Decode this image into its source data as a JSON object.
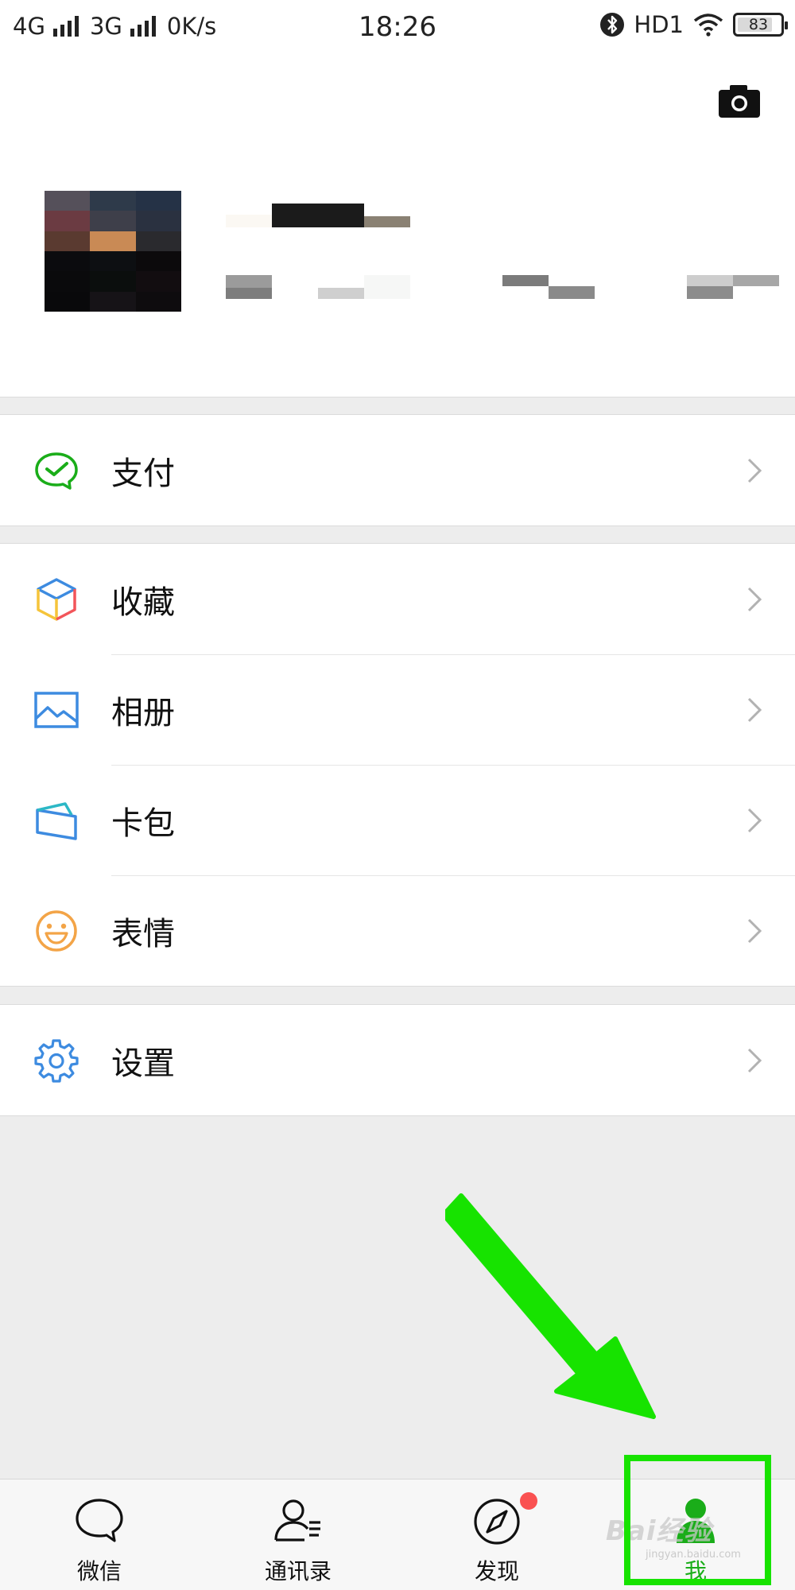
{
  "status_bar": {
    "network1": "4G",
    "network2": "3G",
    "speed": "0K/s",
    "time": "18:26",
    "hd": "HD1",
    "battery": "83",
    "battery_level": 0.83
  },
  "profile": {
    "camera_icon": "camera-icon"
  },
  "menu": {
    "pay": {
      "label": "支付",
      "icon": "pay-icon"
    },
    "favorites": {
      "label": "收藏",
      "icon": "favorites-icon"
    },
    "album": {
      "label": "相册",
      "icon": "album-icon"
    },
    "cards": {
      "label": "卡包",
      "icon": "card-wallet-icon"
    },
    "stickers": {
      "label": "表情",
      "icon": "sticker-icon"
    },
    "settings": {
      "label": "设置",
      "icon": "gear-icon"
    }
  },
  "tabs": [
    {
      "label": "微信",
      "icon": "chat-icon"
    },
    {
      "label": "通讯录",
      "icon": "contacts-icon"
    },
    {
      "label": "发现",
      "icon": "compass-icon",
      "badge": true
    },
    {
      "label": "我",
      "icon": "me-icon",
      "active": true
    }
  ],
  "watermark": {
    "main": "Bai经验",
    "sub": "jingyan.baidu.com"
  },
  "colors": {
    "accent_green": "#1aad19",
    "annotation_green": "#17e300",
    "badge_red": "#fa5151",
    "page_bg": "#ededed"
  }
}
